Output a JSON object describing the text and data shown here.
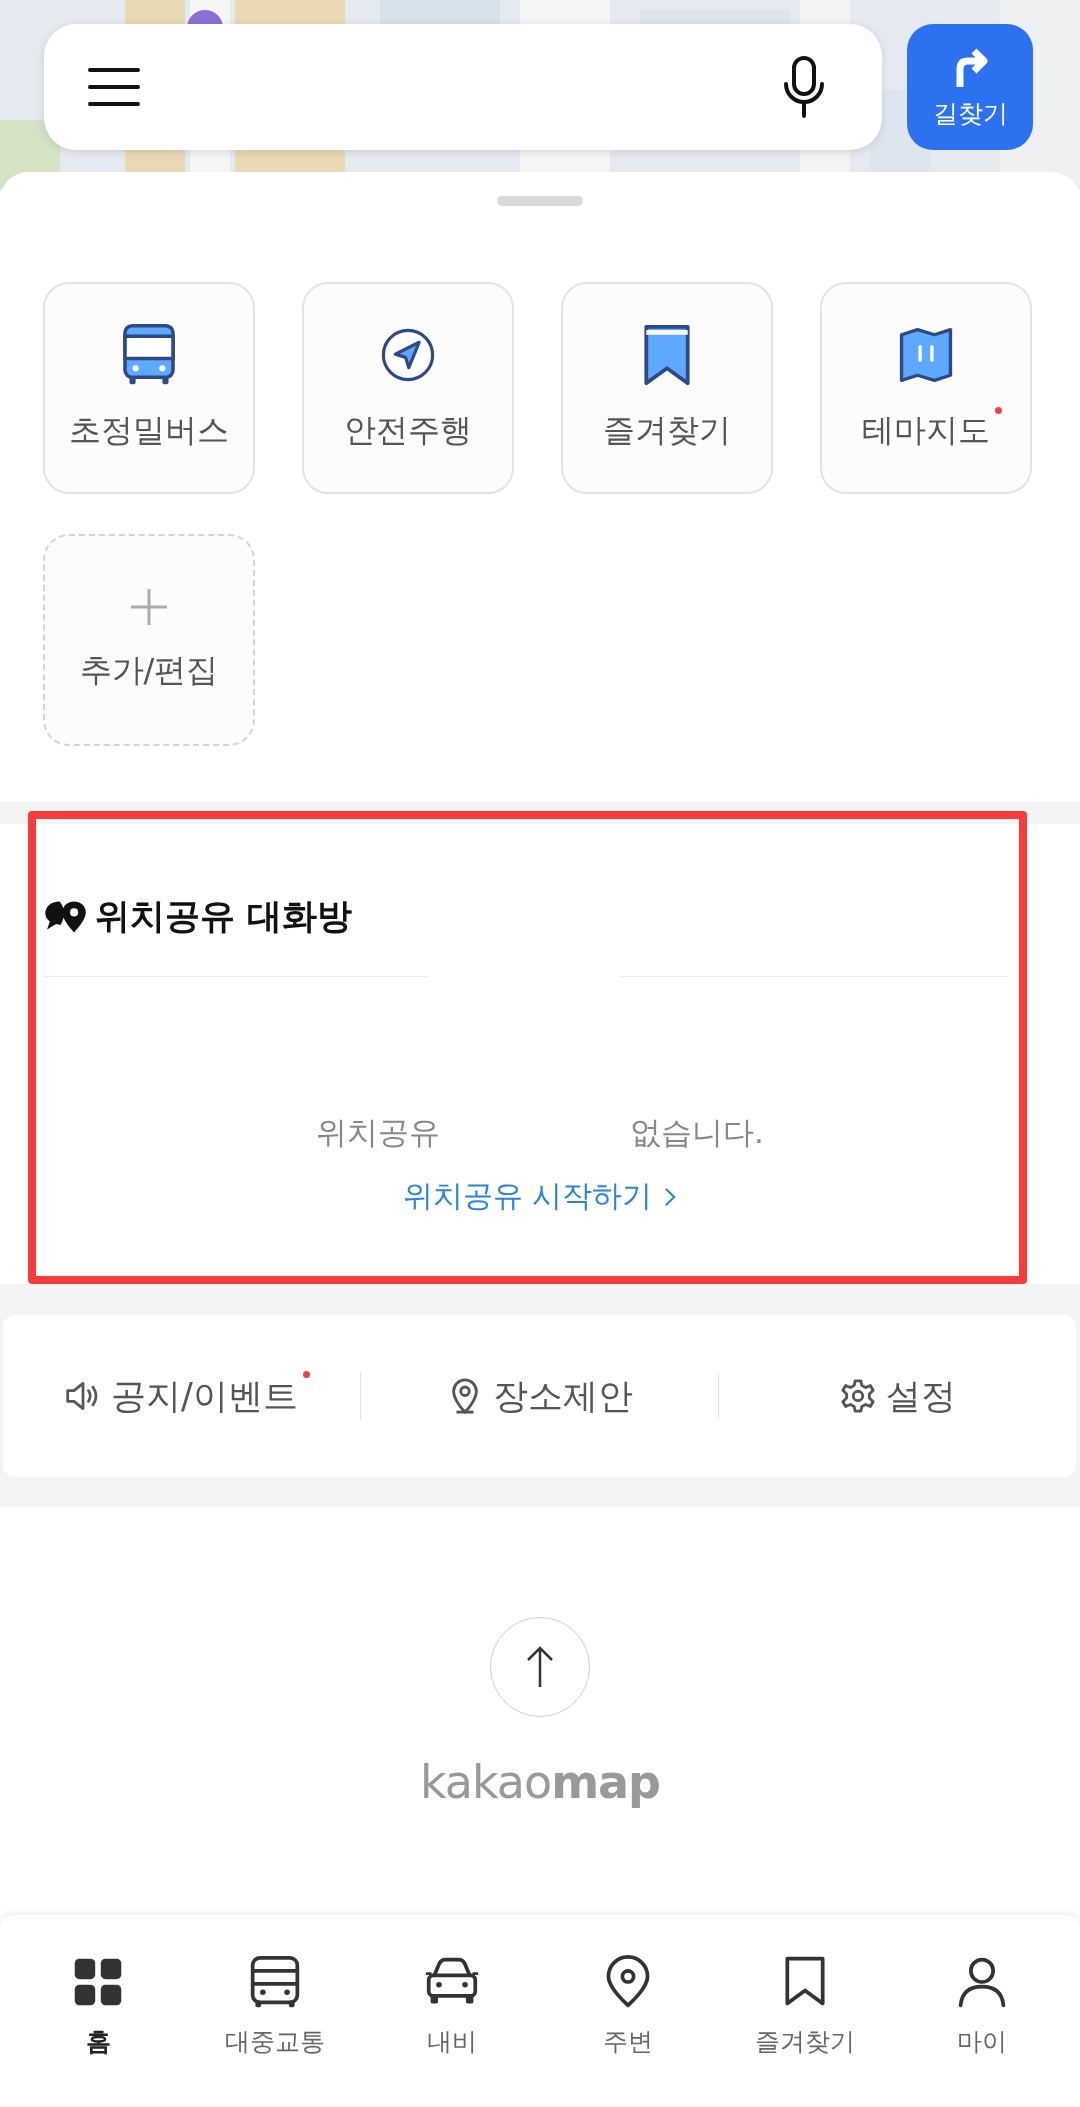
{
  "route_button": {
    "label": "길찾기"
  },
  "shortcuts": [
    {
      "label": "초정밀버스",
      "kind": "bus",
      "new": false
    },
    {
      "label": "안전주행",
      "kind": "drive",
      "new": false
    },
    {
      "label": "즐겨찾기",
      "kind": "bookmark",
      "new": false
    },
    {
      "label": "테마지도",
      "kind": "map",
      "new": true
    },
    {
      "label": "추가/편집",
      "kind": "add",
      "new": false
    }
  ],
  "location_share": {
    "title": "위치공유 대화방",
    "highlighted": true,
    "message_start": "위치공유",
    "message_end": "없습니다.",
    "link": "위치공유 시작하기"
  },
  "quick_links": [
    {
      "label": "공지/이벤트",
      "kind": "notice",
      "new": true
    },
    {
      "label": "장소제안",
      "kind": "place",
      "new": false
    },
    {
      "label": "설정",
      "kind": "settings",
      "new": false
    }
  ],
  "footer": {
    "logo": "kakao**map**"
  },
  "bottom_nav": [
    {
      "label": "홈",
      "kind": "home",
      "selected": true
    },
    {
      "label": "대중교통",
      "kind": "transit",
      "selected": false
    },
    {
      "label": "내비",
      "kind": "car",
      "selected": false
    },
    {
      "label": "주변",
      "kind": "nearby",
      "selected": false
    },
    {
      "label": "즐겨찾기",
      "kind": "bookmark",
      "selected": false
    },
    {
      "label": "마이",
      "kind": "my",
      "selected": false
    }
  ]
}
